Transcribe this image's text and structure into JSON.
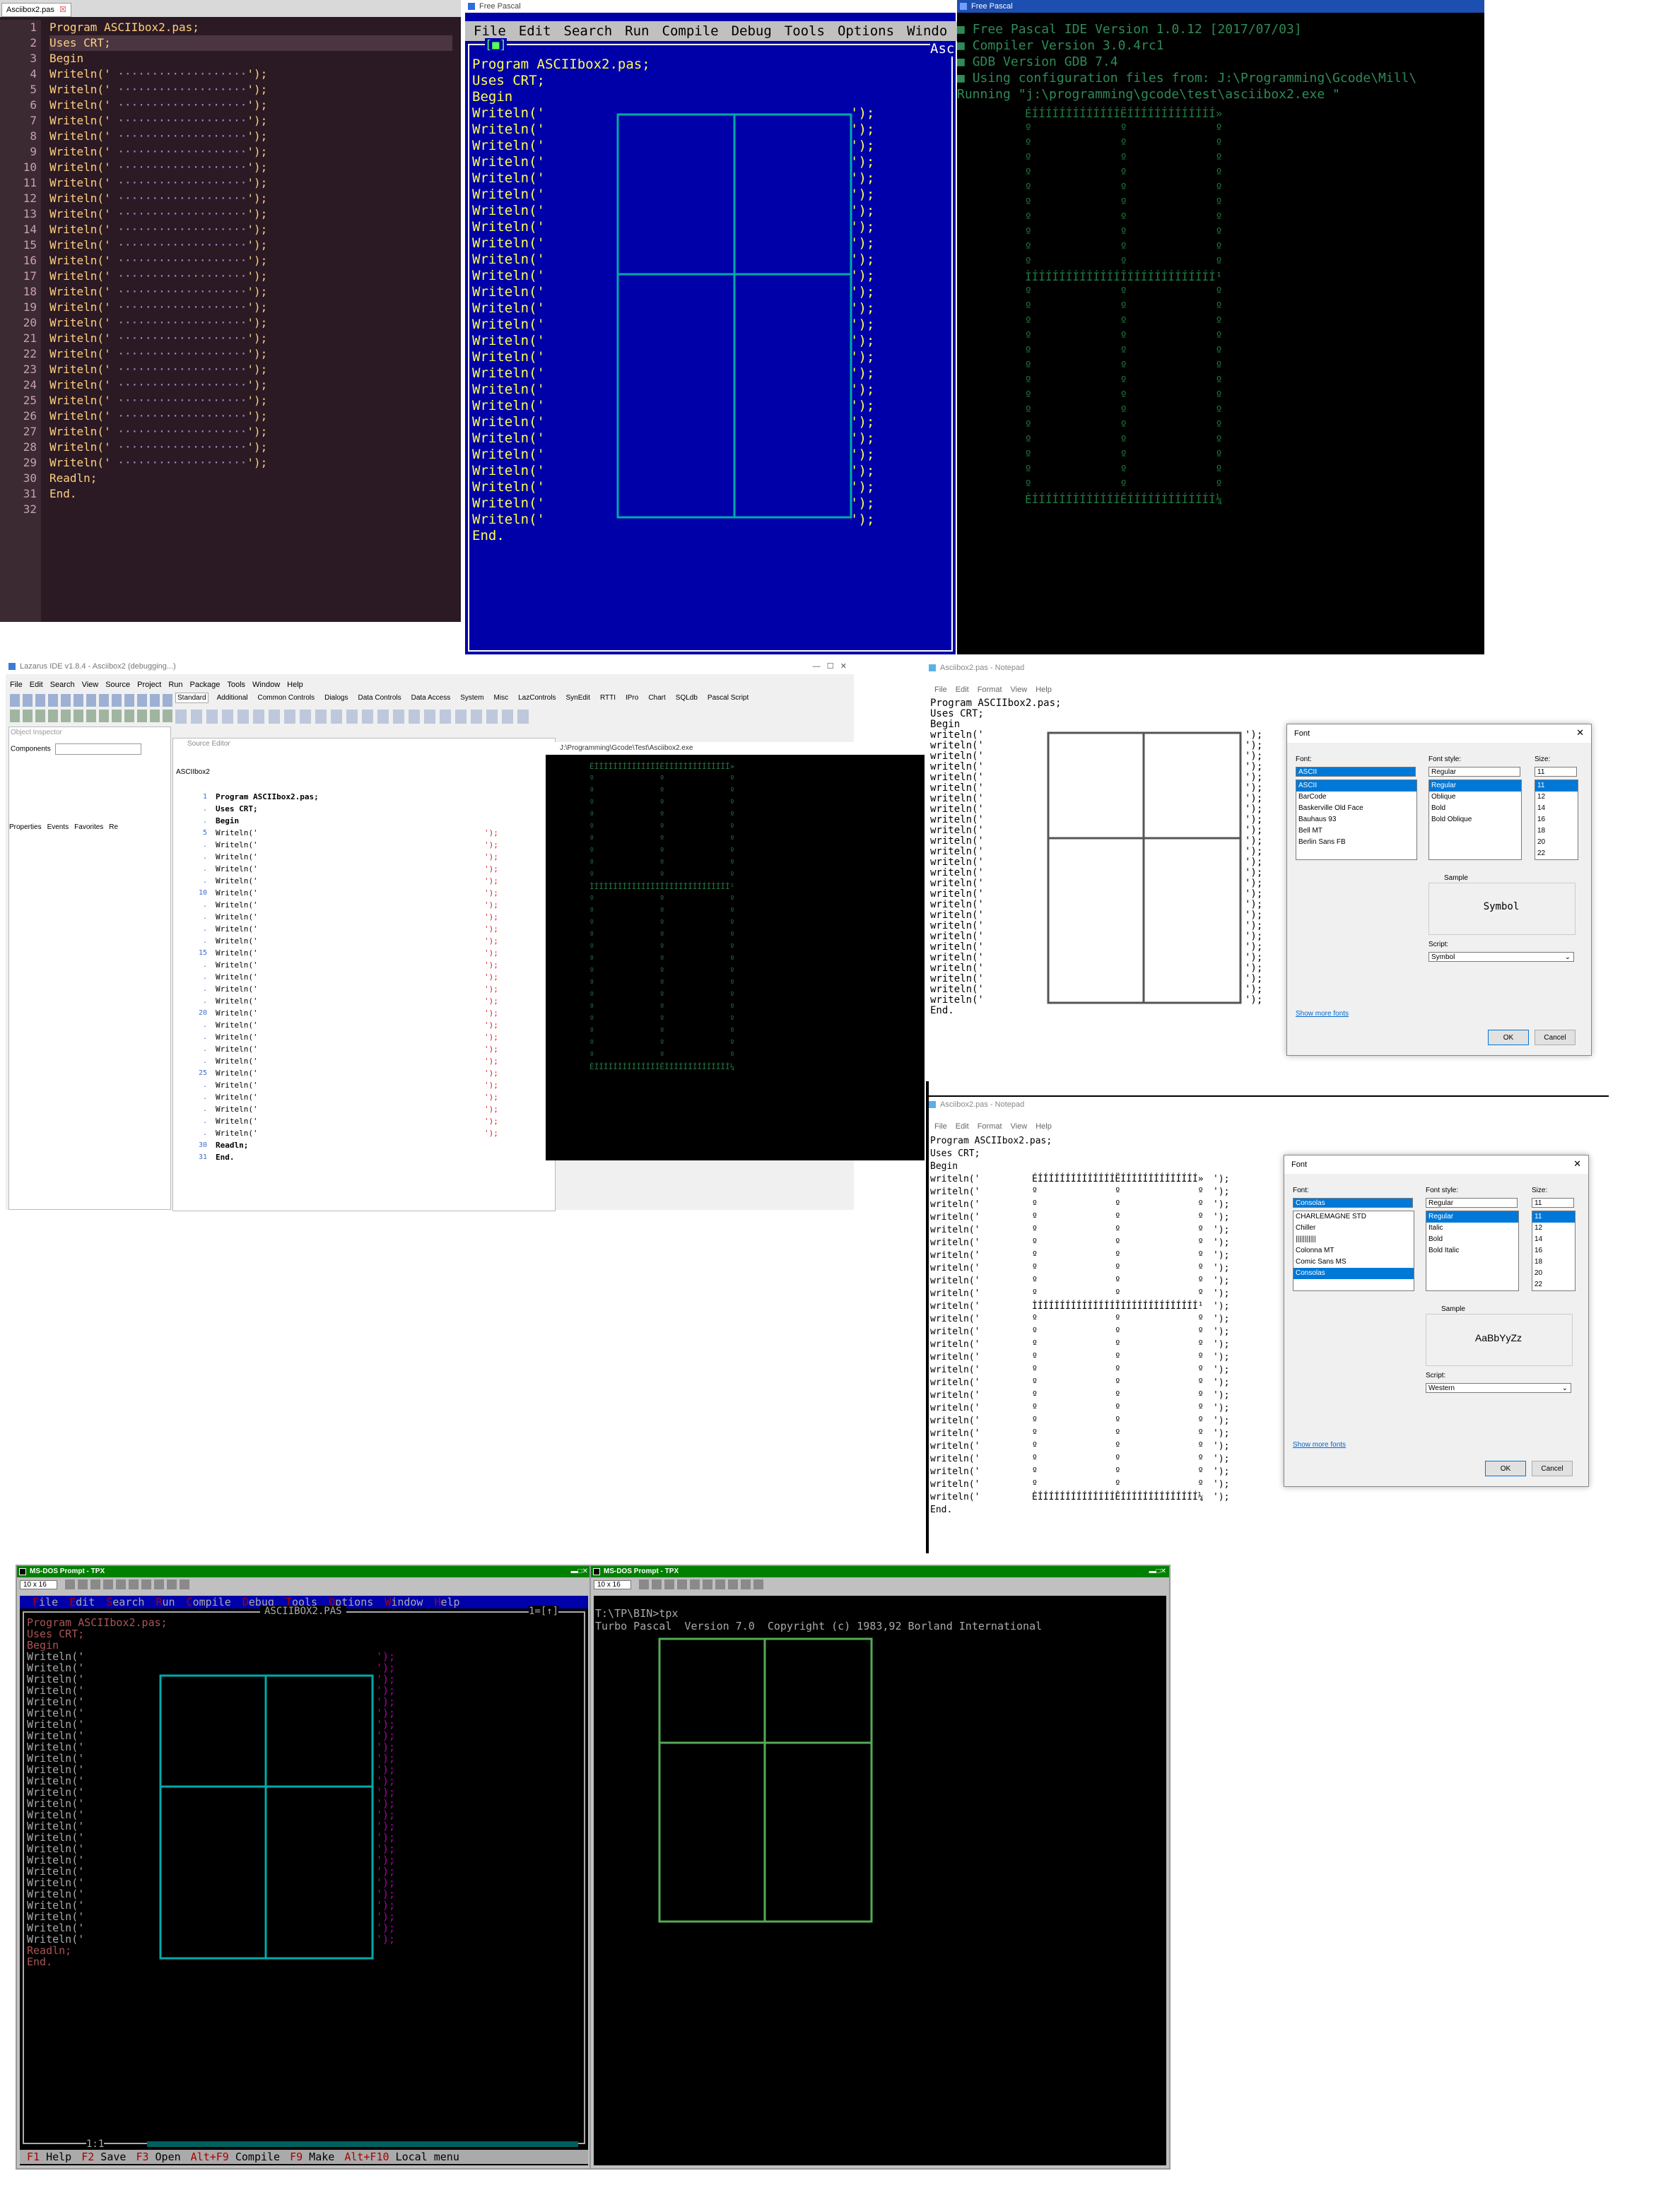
{
  "code": {
    "program": "Program ASCIIbox2.pas;",
    "uses": "Uses CRT;",
    "begin": "Begin",
    "writeln": "Writeln('",
    "writeln_lc": "writeln('",
    "readln": "Readln;",
    "end": "End.",
    "close": "');"
  },
  "panel1": {
    "tab": "Asciibox2.pas",
    "line_numbers": [
      "1",
      "2",
      "3",
      "4",
      "5",
      "6",
      "7",
      "8",
      "9",
      "10",
      "11",
      "12",
      "13",
      "14",
      "15",
      "16",
      "17",
      "18",
      "19",
      "20",
      "21",
      "22",
      "23",
      "24",
      "25",
      "26",
      "27",
      "28",
      "29",
      "30",
      "31",
      "32"
    ]
  },
  "panel2": {
    "title": "Free Pascal",
    "menu": [
      "File",
      "Edit",
      "Search",
      "Run",
      "Compile",
      "Debug",
      "Tools",
      "Options",
      "Windo"
    ],
    "file_tag": "Asc"
  },
  "panel3": {
    "title": "Free Pascal",
    "lines": [
      "Free Pascal IDE Version 1.0.12 [2017/07/03]",
      "Compiler Version 3.0.4rc1",
      "GDB Version GDB 7.4",
      "Using configuration files from: J:\\Programming\\Gcode\\Mill\\",
      "Running \"j:\\programming\\gcode\\test\\asciibox2.exe \""
    ]
  },
  "panel4": {
    "title": "Lazarus IDE v1.8.4 - Asciibox2 (debugging...)",
    "menu": [
      "File",
      "Edit",
      "Search",
      "View",
      "Source",
      "Project",
      "Run",
      "Package",
      "Tools",
      "Window",
      "Help"
    ],
    "tabs": [
      "Standard",
      "Additional",
      "Common Controls",
      "Dialogs",
      "Data Controls",
      "Data Access",
      "System",
      "Misc",
      "LazControls",
      "SynEdit",
      "RTTI",
      "IPro",
      "Chart",
      "SQLdb",
      "Pascal Script"
    ],
    "object_inspector": "Object Inspector",
    "components": "Components",
    "prop_tabs": [
      "Properties",
      "Events",
      "Favorites",
      "Re"
    ],
    "source_editor": "Source Editor",
    "file_tab": "ASCIIbox2",
    "gutter_marks": [
      "1",
      ".",
      ".",
      "5",
      ".",
      ".",
      ".",
      ".",
      "10",
      ".",
      ".",
      ".",
      ".",
      "15",
      ".",
      ".",
      ".",
      ".",
      "20",
      ".",
      ".",
      ".",
      ".",
      "25",
      ".",
      ".",
      ".",
      ".",
      ".",
      "30",
      "31"
    ],
    "run_title": "J:\\Programming\\Gcode\\Test\\Asciibox2.exe"
  },
  "notepad1": {
    "title": "Asciibox2.pas - Notepad",
    "menu": [
      "File",
      "Edit",
      "Format",
      "View",
      "Help"
    ],
    "font_dialog": {
      "title": "Font",
      "font_label": "Font:",
      "font_value": "ASCII",
      "fonts": [
        "ASCII",
        "BarCode",
        "Baskerville Old Face",
        "Bauhaus 93",
        "Bell MT",
        "Berlin Sans FB"
      ],
      "style_label": "Font style:",
      "style_value": "Regular",
      "styles": [
        "Regular",
        "Oblique",
        "Bold",
        "Bold Oblique"
      ],
      "size_label": "Size:",
      "size_value": "11",
      "sizes": [
        "11",
        "12",
        "14",
        "16",
        "18",
        "20",
        "22"
      ],
      "sample_label": "Sample",
      "sample_text": "Symbol",
      "script_label": "Script:",
      "script_value": "Symbol",
      "more_fonts": "Show more fonts",
      "ok": "OK",
      "cancel": "Cancel"
    }
  },
  "notepad2": {
    "title": "Asciibox2.pas - Notepad",
    "menu": [
      "File",
      "Edit",
      "Format",
      "View",
      "Help"
    ],
    "font_dialog": {
      "title": "Font",
      "font_label": "Font:",
      "font_value": "Consolas",
      "fonts": [
        "CHARLEMAGNE STD",
        "Chiller",
        "|||||||||||",
        "Colonna MT",
        "Comic Sans MS",
        "Consolas"
      ],
      "style_label": "Font style:",
      "style_value": "Regular",
      "styles": [
        "Regular",
        "Italic",
        "Bold",
        "Bold Italic"
      ],
      "size_label": "Size:",
      "size_value": "11",
      "sizes": [
        "11",
        "12",
        "14",
        "16",
        "18",
        "20",
        "22"
      ],
      "sample_label": "Sample",
      "sample_text": "AaBbYyZz",
      "script_label": "Script:",
      "script_value": "Western",
      "more_fonts": "Show more fonts",
      "ok": "OK",
      "cancel": "Cancel"
    }
  },
  "dos1": {
    "title": "MS-DOS Prompt - TPX",
    "font_size": "10 x 16",
    "menu": [
      "File",
      "Edit",
      "Search",
      "Run",
      "Compile",
      "Debug",
      "Tools",
      "Options",
      "Window",
      "Help"
    ],
    "file_title": "ASCIIBOX2.PAS",
    "window_num": "1=[↑]",
    "cursor_pos": "1:1",
    "status": [
      {
        "key": "F1",
        "label": "Help"
      },
      {
        "key": "F2",
        "label": "Save"
      },
      {
        "key": "F3",
        "label": "Open"
      },
      {
        "key": "Alt+F9",
        "label": "Compile"
      },
      {
        "key": "F9",
        "label": "Make"
      },
      {
        "key": "Alt+F10",
        "label": "Local menu"
      }
    ]
  },
  "dos2": {
    "title": "MS-DOS Prompt - TPX",
    "font_size": "10 x 16",
    "prompt": "T:\\TP\\BIN>tpx",
    "banner": "Turbo Pascal  Version 7.0  Copyright (c) 1983,92 Borland International"
  },
  "colors": {
    "fp_blue": "#0000a8",
    "fp_yellow": "#ffff55",
    "fp_cyan": "#55ffff",
    "npp_bg": "#2b1a24",
    "term_green": "#3cb371",
    "tp_green": "#6fcf6f"
  }
}
